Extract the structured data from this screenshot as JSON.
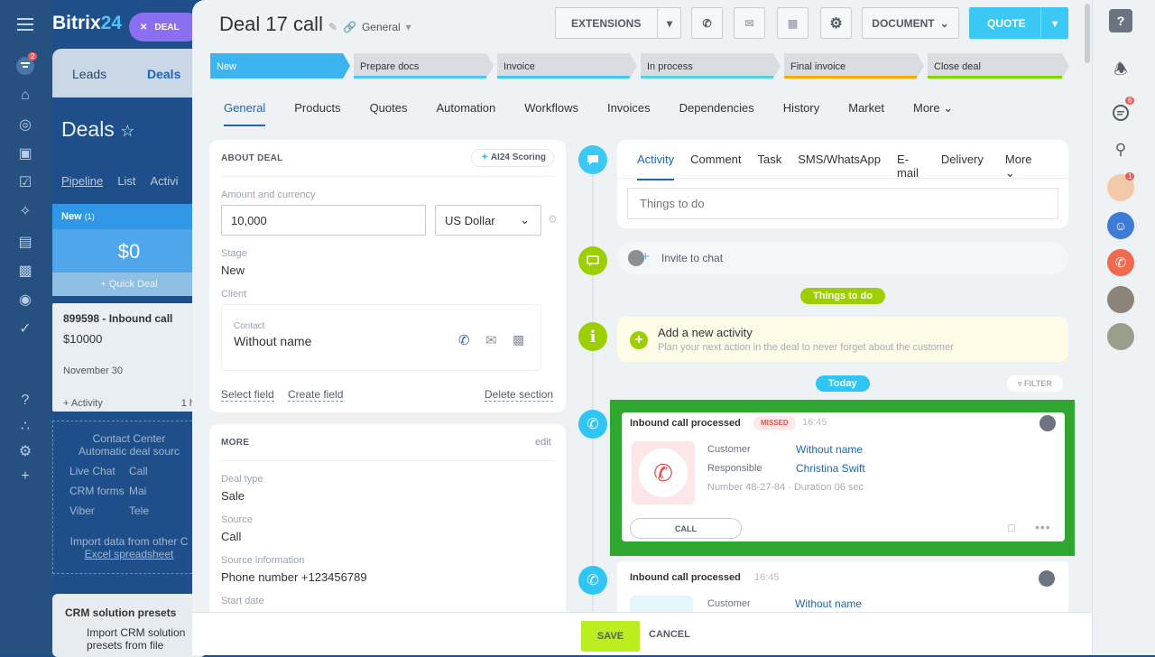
{
  "brand": {
    "name": "Bitrix",
    "suffix": "24"
  },
  "deal_chip": "DEAL",
  "background_crm": {
    "tabs": [
      "Leads",
      "Deals"
    ],
    "title": "Deals",
    "views": [
      "Pipeline",
      "List",
      "Activi"
    ],
    "column": {
      "name": "New",
      "count": "(1)",
      "sum": "$0",
      "quick": "Quick Deal"
    },
    "card": {
      "title": "899598 - Inbound call",
      "amount": "$10000",
      "date": "November 30",
      "activity": "+ Activity",
      "time": "1 h"
    },
    "contact_center": {
      "title": "Contact Center",
      "subtitle": "Automatic deal sourc",
      "items": [
        "Live Chat",
        "Call",
        "CRM forms",
        "Mai",
        "Viber",
        "Tele"
      ],
      "import_line1": "Import data from other C",
      "import_line2": "Excel spreadsheet"
    },
    "presets": {
      "title": "CRM solution presets",
      "line1": "Import CRM solution",
      "line2": "presets from file"
    }
  },
  "leftnav_badge": "2",
  "deal": {
    "title": "Deal 17 call",
    "category": "General",
    "buttons": {
      "extensions": "EXTENSIONS",
      "document": "DOCUMENT",
      "quote": "QUOTE"
    },
    "stages": [
      {
        "label": "Prepare docs",
        "color": "#4fc3f7"
      },
      {
        "label": "Invoice",
        "color": "#3bc8f5"
      },
      {
        "label": "In process",
        "color": "#ab7ef0"
      },
      {
        "label": "Final invoice",
        "color": "#ffa900"
      },
      {
        "label": "Close deal",
        "color": "#7bd500"
      }
    ],
    "active_stage": "New",
    "tabs": [
      "General",
      "Products",
      "Quotes",
      "Automation",
      "Workflows",
      "Invoices",
      "Dependencies",
      "History",
      "Market",
      "More"
    ],
    "about": {
      "heading": "ABOUT DEAL",
      "scoring": "AI24 Scoring",
      "amount_label": "Amount and currency",
      "amount": "10,000",
      "currency": "US Dollar",
      "stage_label": "Stage",
      "stage": "New",
      "client_label": "Client",
      "contact_label": "Contact",
      "contact_name": "Without name",
      "links": [
        "Select field",
        "Create field",
        "Delete section"
      ]
    },
    "more": {
      "heading": "MORE",
      "edit": "edit",
      "deal_type_label": "Deal type",
      "deal_type": "Sale",
      "source_label": "Source",
      "source": "Call",
      "source_info_label": "Source information",
      "source_info": "Phone number +123456789",
      "start_date_label": "Start date"
    }
  },
  "timeline": {
    "tabs": [
      "Activity",
      "Comment",
      "Task",
      "SMS/WhatsApp",
      "E-mail",
      "Delivery",
      "More"
    ],
    "todo_placeholder": "Things to do",
    "invite": "Invite to chat",
    "things_pill": "Things to do",
    "add_activity": "Add a new activity",
    "add_activity_hint": "Plan your next action in the deal to never forget about the customer",
    "today": "Today",
    "filter": "FILTER",
    "call1": {
      "title": "Inbound call processed",
      "badge": "MISSED",
      "time": "16:45",
      "customer_label": "Customer",
      "customer": "Without name",
      "responsible_label": "Responsible",
      "responsible": "Christina Swift",
      "details": "Number 48-27-84 · Duration 06 sec",
      "call_btn": "CALL"
    },
    "call2": {
      "title": "Inbound call processed",
      "time": "16:45",
      "customer_label": "Customer",
      "customer": "Without name"
    }
  },
  "footer": {
    "save": "SAVE",
    "cancel": "CANCEL"
  },
  "rightbar": {
    "chat_badge": "6",
    "avatar_badge": "1"
  },
  "colors": {
    "accent": "#3bc8f5",
    "green": "#9dcf00",
    "highlight": "#2fa62f",
    "save": "#bbed21"
  }
}
